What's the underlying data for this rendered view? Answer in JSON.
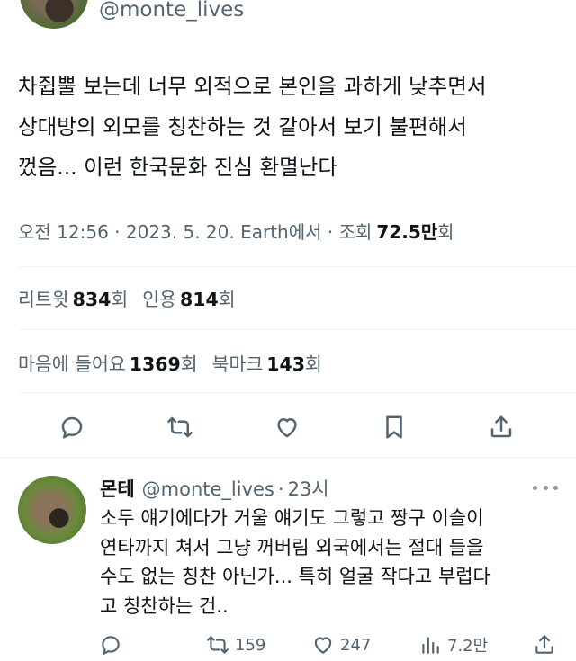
{
  "tweet": {
    "handle": "@monte_lives",
    "text": "차쥡뿔 보는데 너무 외적으로 본인을 과하게 낮추면서\n상대방의 외모를 칭찬하는 것 같아서 보기 불편해서\n껐음... 이런 한국문화 진심 환멸난다",
    "meta_time": "오전 12:56 · 2023. 5. 20. Earth에서 · 조회",
    "views_value": "72.5만",
    "views_unit": "회",
    "retweets_label": "리트윗",
    "retweets_value": "834",
    "retweets_unit": "회",
    "quotes_label": "인용",
    "quotes_value": "814",
    "quotes_unit": "회",
    "likes_label": "마음에 들어요",
    "likes_value": "1369",
    "likes_unit": "회",
    "bookmarks_label": "북마크",
    "bookmarks_value": "143",
    "bookmarks_unit": "회",
    "action_icons": [
      "reply-icon",
      "retweet-icon",
      "like-icon",
      "bookmark-icon",
      "share-icon"
    ]
  },
  "reply": {
    "name": "몬테",
    "handle": "@monte_lives",
    "separator": "·",
    "time": "23시",
    "text": "소두 얘기에다가 거울 얘기도 그렇고 짱구 이슬이\n연타까지 쳐서 그냥 꺼버림 외국에서는 절대 들을\n수도 없는 칭찬 아닌가... 특히 얼굴 작다고 부럽다\n고 칭찬하는 건..",
    "retweets": "159",
    "likes": "247",
    "views": "7.2만"
  }
}
